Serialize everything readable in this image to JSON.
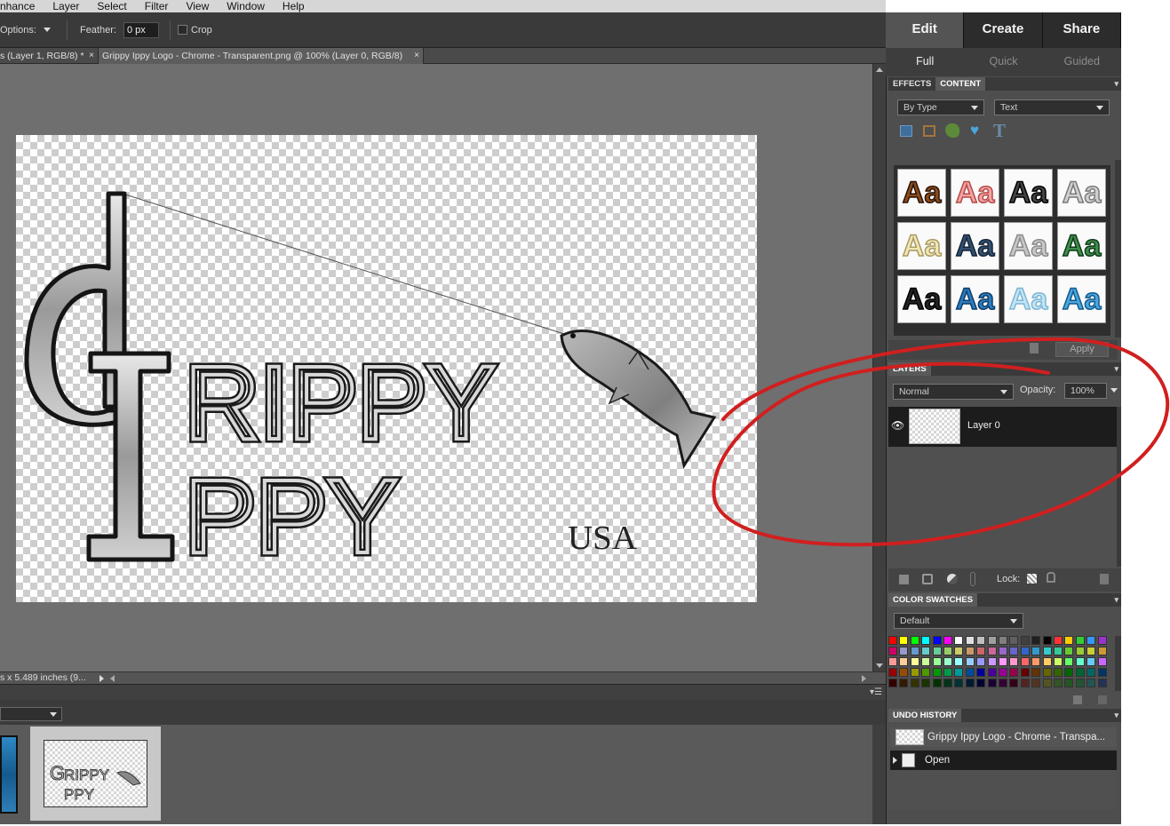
{
  "menu": [
    "nhance",
    "Layer",
    "Select",
    "Filter",
    "View",
    "Window",
    "Help"
  ],
  "options_bar": {
    "options_label": "Options:",
    "feather_label": "Feather:",
    "feather_value": "0 px",
    "crop_label": "Crop"
  },
  "doc_tabs": [
    {
      "label": "s (Layer 1, RGB/8) *",
      "active": false
    },
    {
      "label": "Grippy Ippy Logo - Chrome - Transparent.png @ 100% (Layer 0, RGB/8)",
      "active": true
    }
  ],
  "tab_close": "×",
  "canvas": {
    "logo_line1": "RIPPY",
    "logo_line2": "PPY",
    "logo_initial_g": "G",
    "logo_initial_i": "I",
    "tagline": "USA"
  },
  "status_text": "s x 5.489 inches (9...",
  "right_panel": {
    "main_tabs": [
      "Edit",
      "Create",
      "Share"
    ],
    "sub_tabs": [
      "Full",
      "Quick",
      "Guided"
    ],
    "effects_tab": "EFFECTS",
    "content_tab": "CONTENT",
    "by_type_value": "By Type",
    "text_value": "Text",
    "apply_label": "Apply",
    "layers": {
      "header": "LAYERS",
      "blend_mode": "Normal",
      "opacity_label": "Opacity:",
      "opacity_value": "100%",
      "layer_name": "Layer 0",
      "lock_label": "Lock:"
    },
    "swatches": {
      "header": "COLOR SWATCHES",
      "preset": "Default"
    },
    "undo": {
      "header": "UNDO HISTORY",
      "items": [
        "Grippy Ippy Logo - Chrome - Transpa...",
        "Open"
      ]
    }
  },
  "text_styles": [
    {
      "fill": "#8a4b1c",
      "stroke": "#2a1206"
    },
    {
      "fill": "#f4a3a0",
      "stroke": "#b34a4a"
    },
    {
      "fill": "#444444",
      "stroke": "#000000"
    },
    {
      "fill": "#d0d0d0",
      "stroke": "#7a7a7a"
    },
    {
      "fill": "#f1e6b8",
      "stroke": "#a99b5e"
    },
    {
      "fill": "#33506e",
      "stroke": "#15243a"
    },
    {
      "fill": "#c8c8c8",
      "stroke": "#8a8a8a"
    },
    {
      "fill": "#3e8e4a",
      "stroke": "#0f3a1a"
    },
    {
      "fill": "#222222",
      "stroke": "#000000"
    },
    {
      "fill": "#2c7bc0",
      "stroke": "#0f3d66"
    },
    {
      "fill": "#bfe6f7",
      "stroke": "#7fb5d0"
    },
    {
      "fill": "#4aa6df",
      "stroke": "#135a8c"
    }
  ],
  "annotation_color": "#d11f1f",
  "accent_colors": {
    "panel_bg": "#4e4e4e",
    "canvas_bg": "#6f6f6f"
  }
}
